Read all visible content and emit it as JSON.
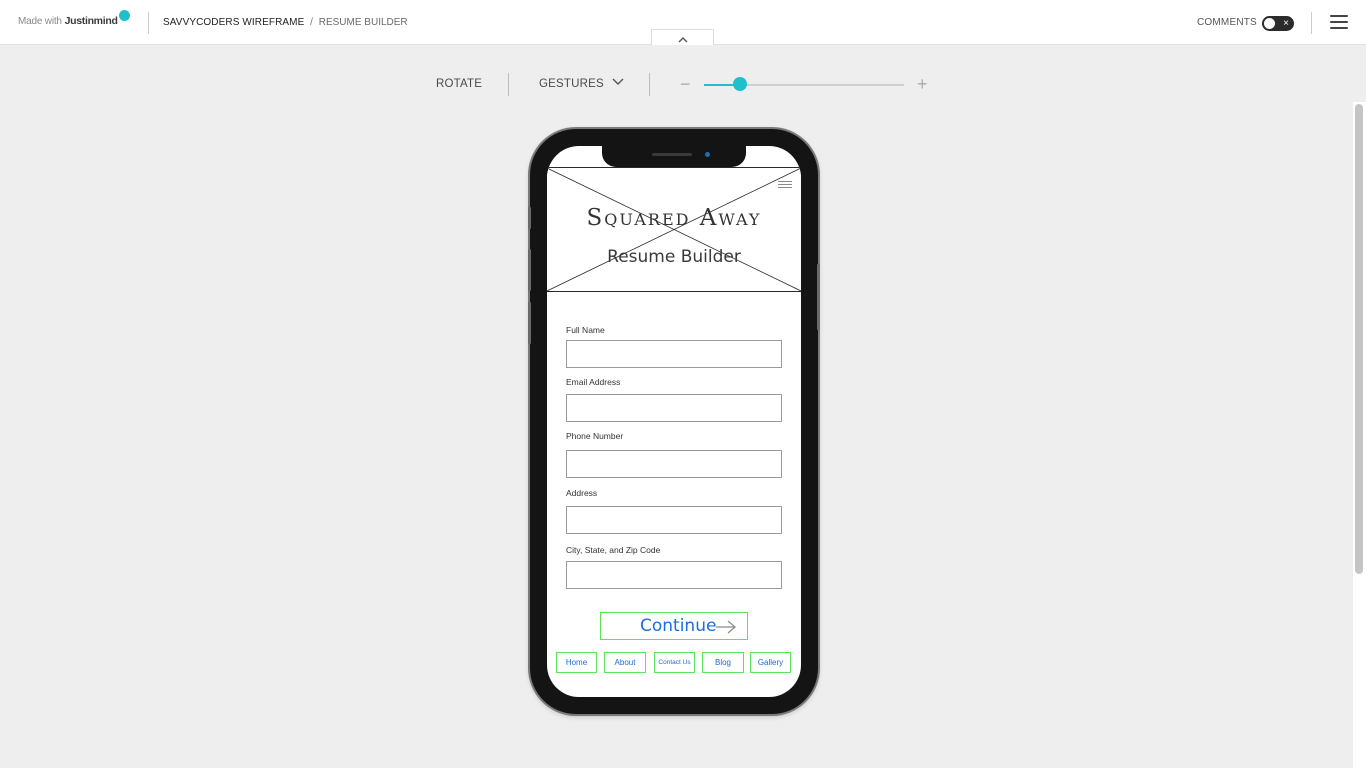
{
  "header": {
    "made_with": "Made with",
    "brand": "Justinmind",
    "project": "SAVVYCODERS WIREFRAME",
    "separator": "/",
    "page": "RESUME BUILDER",
    "comments_label": "COMMENTS",
    "comments_toggle_glyph": "×",
    "accent_color": "#1fbfcc"
  },
  "toolbar": {
    "rotate": "ROTATE",
    "gestures": "GESTURES",
    "zoom_minus": "−",
    "zoom_plus": "+",
    "zoom_level_fraction": 0.18
  },
  "app": {
    "hero_title": "Squared Away",
    "hero_subtitle": "Resume Builder",
    "form": {
      "full_name_label": "Full Name",
      "full_name_value": "",
      "email_label": "Email Address",
      "email_value": "",
      "phone_label": "Phone Number",
      "phone_value": "",
      "address_label": "Address",
      "address_value": "",
      "city_label": "City, State, and Zip Code",
      "city_value": ""
    },
    "continue_label": "Continue",
    "nav": {
      "home": "Home",
      "about": "About",
      "contact": "Contact Us",
      "blog": "Blog",
      "gallery": "Gallery"
    }
  }
}
